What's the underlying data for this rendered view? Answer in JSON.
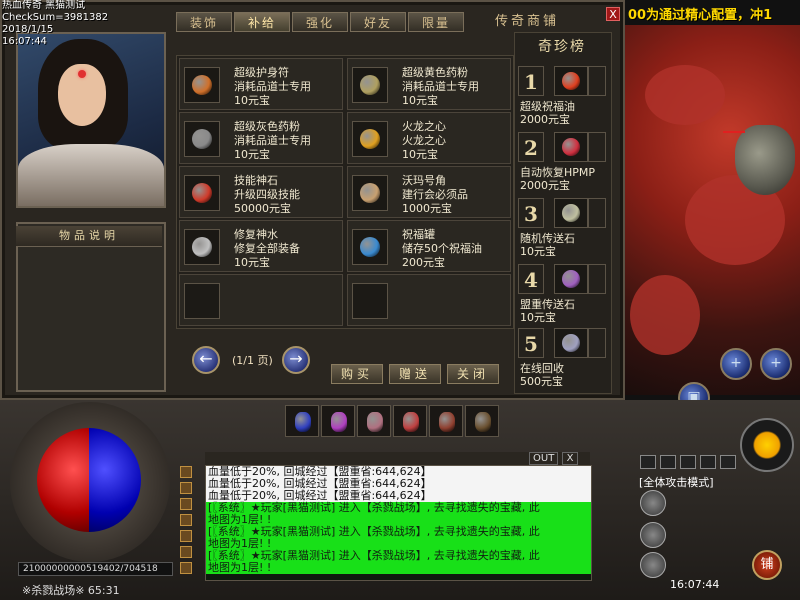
{
  "overlay": {
    "line1": "热血传奇 黑猫测试",
    "line2": "CheckSum=3981382",
    "line3": "2018/1/15",
    "line4": "16:07:44"
  },
  "marquee": "00为通过精心配置，冲1",
  "shop": {
    "title": "传奇商铺",
    "close_label": "X",
    "tabs": [
      {
        "label": "装饰"
      },
      {
        "label": "补给"
      },
      {
        "label": "强化"
      },
      {
        "label": "好友"
      },
      {
        "label": "限量"
      }
    ],
    "desc_title": "物品说明",
    "items": [
      {
        "name": "超级护身符",
        "desc": "消耗品道士专用",
        "price": "10元宝",
        "color": "#d0702a"
      },
      {
        "name": "超级黄色药粉",
        "desc": "消耗品道士专用",
        "price": "10元宝",
        "color": "#b0a060"
      },
      {
        "name": "超级灰色药粉",
        "desc": "消耗品道士专用",
        "price": "10元宝",
        "color": "#8a8a8a"
      },
      {
        "name": "火龙之心",
        "desc": "火龙之心",
        "price": "10元宝",
        "color": "#e0a020"
      },
      {
        "name": "技能神石",
        "desc": "升级四级技能",
        "price": "50000元宝",
        "color": "#d03a2a"
      },
      {
        "name": "沃玛号角",
        "desc": "建行会必须品",
        "price": "1000元宝",
        "color": "#c8a070"
      },
      {
        "name": "修复神水",
        "desc": "修复全部装备",
        "price": "10元宝",
        "color": "#c0c0c0"
      },
      {
        "name": "祝福罐",
        "desc": "储存50个祝福油",
        "price": "200元宝",
        "color": "#3a8ad0"
      }
    ],
    "pager_text": "(1/1 页)",
    "buy_label": "购买",
    "gift_label": "赠送",
    "close_btn_label": "关闭",
    "rank_title": "奇珍榜",
    "ranks": [
      {
        "num": "1",
        "name": "超级祝福油",
        "price": "2000元宝",
        "color": "#e04020"
      },
      {
        "num": "2",
        "name": "自动恢复HPMP",
        "price": "2000元宝",
        "color": "#d03040"
      },
      {
        "num": "3",
        "name": "随机传送石",
        "price": "10元宝",
        "color": "#c0c0a0"
      },
      {
        "num": "4",
        "name": "盟重传送石",
        "price": "10元宝",
        "color": "#a060c0"
      },
      {
        "num": "5",
        "name": "在线回收",
        "price": "500元宝",
        "color": "#a0a0c0"
      }
    ]
  },
  "hud": {
    "exp_text": "21000000000519402/704518",
    "map_text": "※杀戮战场※ 65:31",
    "out_label": "OUT",
    "close_label": "X",
    "attack_mode": "[全体攻击模式]",
    "clock": "16:07:44",
    "shop_btn": "铺",
    "belt_colors": [
      "#3040c0",
      "#b040c0",
      "#b07080",
      "#c04040",
      "#904030",
      "#6a5030"
    ]
  },
  "chat": [
    {
      "type": "bw",
      "text": "血量低于20%, 回城经过【盟重省:644,624】"
    },
    {
      "type": "bw",
      "text": "血量低于20%, 回城经过【盟重省:644,624】"
    },
    {
      "type": "bw",
      "text": "血量低于20%, 回城经过【盟重省:644,624】"
    },
    {
      "type": "sys",
      "text": "[〖系统〗★玩家[黑猫测试] 进入【杀戮战场】, 去寻找遗失的宝藏, 此"
    },
    {
      "type": "sys",
      "text": " 地图为1层! !"
    },
    {
      "type": "sys",
      "text": "[〖系统〗★玩家[黑猫测试] 进入【杀戮战场】, 去寻找遗失的宝藏, 此"
    },
    {
      "type": "sys",
      "text": " 地图为1层! !"
    },
    {
      "type": "sys",
      "text": "[〖系统〗★玩家[黑猫测试] 进入【杀戮战场】, 去寻找遗失的宝藏, 此"
    },
    {
      "type": "sys",
      "text": " 地图为1层! !"
    }
  ]
}
